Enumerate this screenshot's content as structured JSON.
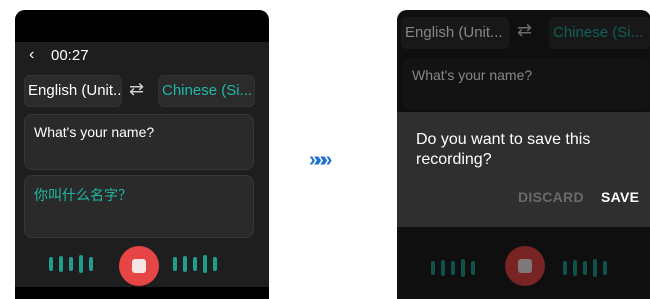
{
  "step_arrow": "»»»",
  "left_screen": {
    "back_icon": "chevron-left-icon",
    "timer": "00:27",
    "source_language": "English (Unit...",
    "target_language": "Chinese (Si...",
    "swap_icon": "swap-arrows-icon",
    "source_text": "What's your name?",
    "translated_text": "你叫什么名字？",
    "stop_icon": "stop-icon"
  },
  "right_screen": {
    "source_language": "English (Unit...",
    "target_language": "Chinese (Si...",
    "swap_icon": "swap-arrows-icon",
    "source_text": "What's your name?",
    "dialog": {
      "message": "Do you want to save this recording?",
      "discard_label": "DISCARD",
      "save_label": "SAVE"
    }
  },
  "colors": {
    "accent_teal": "#1fb8a6",
    "record_red": "#e64545",
    "arrow_blue": "#1f6fd6"
  }
}
